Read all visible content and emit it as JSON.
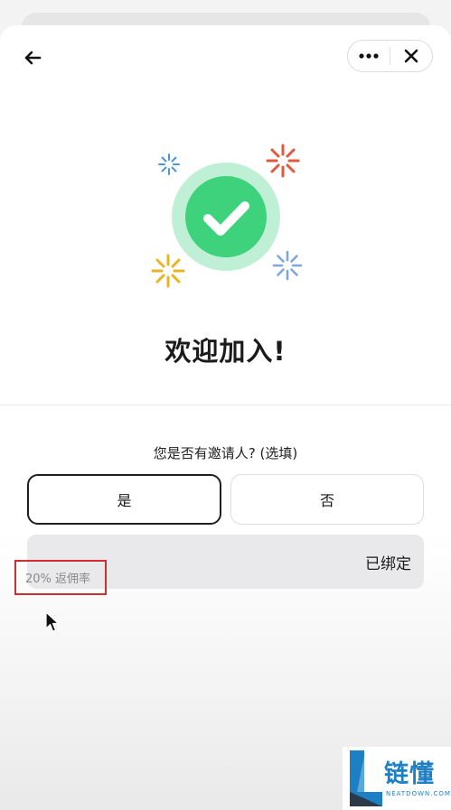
{
  "header": {
    "back_icon": "arrow-left-icon",
    "more_icon": "more-horizontal-icon",
    "close_icon": "close-icon"
  },
  "hero": {
    "check_icon": "checkmark-icon",
    "sparkle_icons": [
      "sparkle-blue-icon",
      "sparkle-red-icon",
      "sparkle-yellow-icon",
      "sparkle-periwinkle-icon"
    ],
    "colors": {
      "check_outer_ring": "#bff0d6",
      "check_inner": "#3fd27d",
      "sparkle_blue": "#4a97d6",
      "sparkle_red": "#e0593c",
      "sparkle_yellow": "#e6b51f",
      "sparkle_periwinkle": "#7fa5e6"
    }
  },
  "welcome_text": "欢迎加入!",
  "form": {
    "question": "您是否有邀请人? (选填)",
    "yes_label": "是",
    "no_label": "否",
    "selected": "是",
    "invite_field_value": "已绑定",
    "rebate_label": "20% 返佣率",
    "highlight_color": "#cf2e2e"
  },
  "watermark": {
    "brand": "链懂",
    "url": "NEATDOWN.COM"
  }
}
